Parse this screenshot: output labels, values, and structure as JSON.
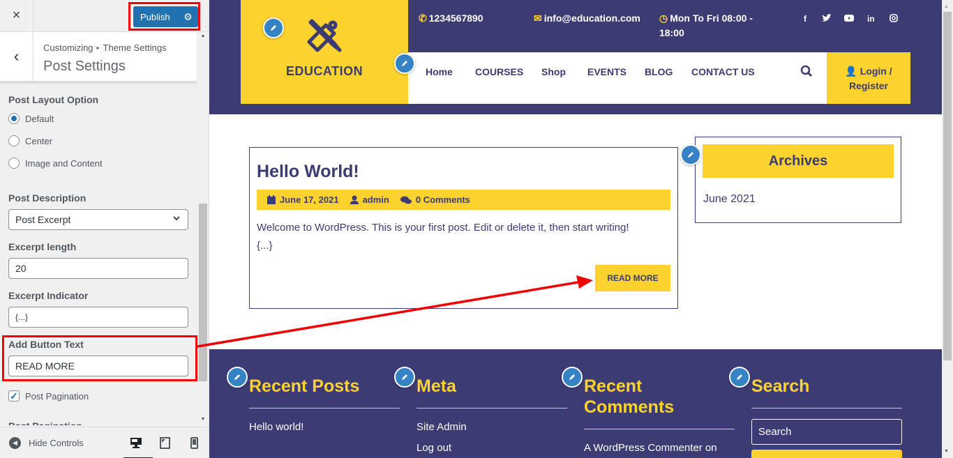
{
  "customizer": {
    "close_label": "×",
    "publish_label": "Publish",
    "breadcrumb": {
      "root": "Customizing",
      "separator": "▸",
      "parent": "Theme Settings"
    },
    "section_title": "Post Settings",
    "controls": {
      "post_layout": {
        "label": "Post Layout Option",
        "options": [
          {
            "label": "Default",
            "selected": true
          },
          {
            "label": "Center",
            "selected": false
          },
          {
            "label": "Image and Content",
            "selected": false
          }
        ]
      },
      "post_description": {
        "label": "Post Description",
        "value": "Post Excerpt"
      },
      "excerpt_length": {
        "label": "Excerpt length",
        "value": "20"
      },
      "excerpt_indicator": {
        "label": "Excerpt Indicator",
        "value": "{...}"
      },
      "button_text": {
        "label": "Add Button Text",
        "value": "READ MORE"
      },
      "post_pagination": {
        "label": "Post Pagination",
        "checked": true
      },
      "post_pagination_cut": {
        "label": "Post Pagination"
      }
    },
    "footer": {
      "hide_controls_label": "Hide Controls",
      "devices": [
        "desktop",
        "tablet",
        "mobile"
      ],
      "active_device": "desktop"
    }
  },
  "site": {
    "brand": {
      "name": "EDUCATION"
    },
    "topbar": {
      "phone": "1234567890",
      "email": "info@education.com",
      "hours_line1": "Mon To Fri 08:00 -",
      "hours_line2": "18:00"
    },
    "social": [
      "facebook",
      "twitter",
      "youtube",
      "linkedin",
      "instagram"
    ],
    "nav": [
      "Home",
      "COURSES",
      "Shop",
      "EVENTS",
      "BLOG",
      "CONTACT US"
    ],
    "login": {
      "line1": "Login /",
      "line2": "Register"
    },
    "post": {
      "title": "Hello World!",
      "date": "June 17, 2021",
      "author": "admin",
      "comments": "0 Comments",
      "excerpt": "Welcome to WordPress. This is your first post. Edit or delete it, then start writing!",
      "indicator": "{...}",
      "button": "READ MORE"
    },
    "sidebar": {
      "archives_title": "Archives",
      "archives_items": [
        "June 2021"
      ]
    },
    "footer": {
      "recent_posts": {
        "title": "Recent Posts",
        "items": [
          "Hello world!"
        ]
      },
      "meta": {
        "title": "Meta",
        "items": [
          "Site Admin",
          "Log out"
        ]
      },
      "recent_comments": {
        "title_line1": "Recent",
        "title_line2": "Comments",
        "items": [
          "A WordPress Commenter on"
        ]
      },
      "search": {
        "title": "Search",
        "placeholder": "Search"
      }
    }
  },
  "colors": {
    "primary": "#3d3b74",
    "accent": "#fcd22f",
    "wp_blue": "#2271b1",
    "annotation": "#ee0000"
  }
}
